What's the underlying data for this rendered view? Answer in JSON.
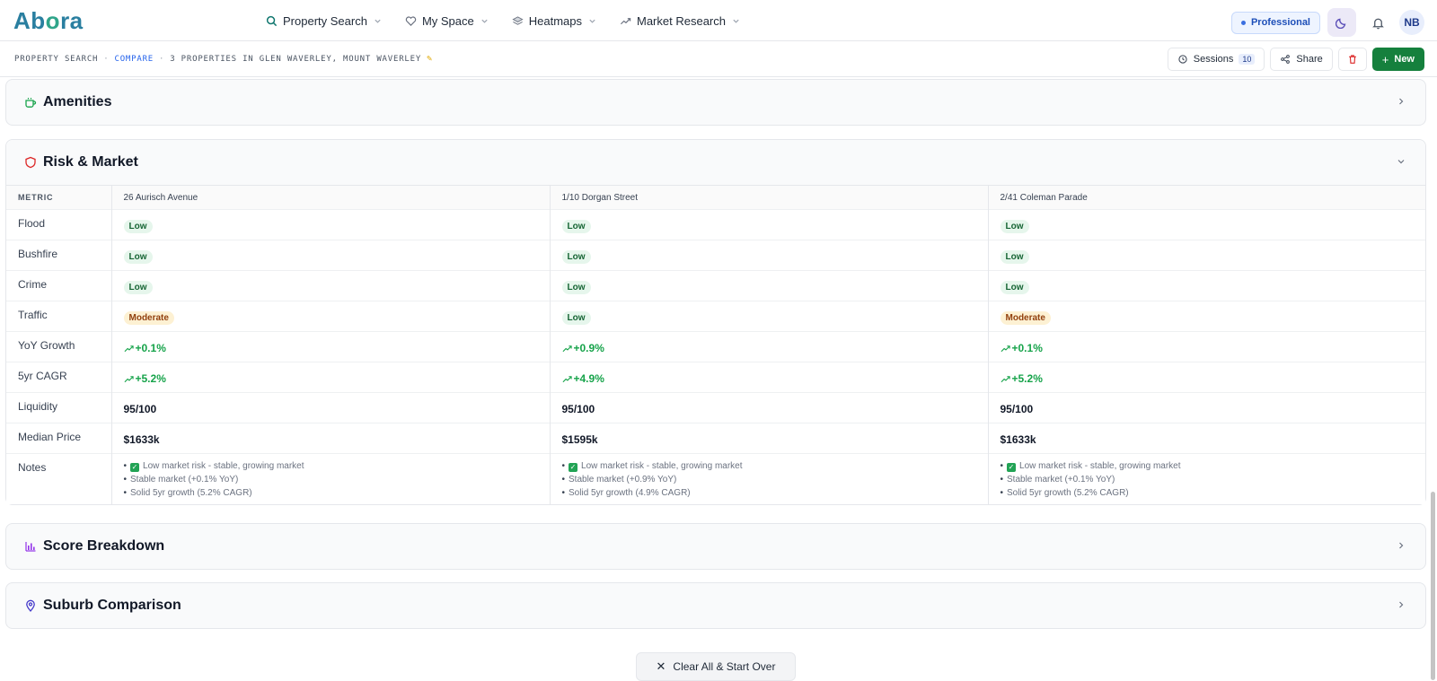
{
  "app": {
    "logo": {
      "a": "Ab",
      "o": "o",
      "ra": "ra"
    }
  },
  "nav": {
    "items": [
      {
        "label": "Property Search",
        "icon": "search-icon"
      },
      {
        "label": "My Space",
        "icon": "heart-icon"
      },
      {
        "label": "Heatmaps",
        "icon": "layers-icon"
      },
      {
        "label": "Market Research",
        "icon": "trend-icon"
      }
    ],
    "plan_badge": "Professional",
    "avatar_initials": "NB"
  },
  "breadcrumb": {
    "part1": "PROPERTY SEARCH",
    "sep": "·",
    "part2": "COMPARE",
    "part3": "3 PROPERTIES IN GLEN WAVERLEY, MOUNT WAVERLEY"
  },
  "toolbar": {
    "sessions_label": "Sessions",
    "sessions_count": "10",
    "share_label": "Share",
    "new_label": "New"
  },
  "sections": {
    "amenities": "Amenities",
    "risk": "Risk & Market",
    "score": "Score Breakdown",
    "suburb": "Suburb Comparison"
  },
  "risk_table": {
    "metric_header": "METRIC",
    "properties": [
      "26 Aurisch Avenue",
      "1/10 Dorgan Street",
      "2/41 Coleman Parade"
    ],
    "rows": {
      "flood": {
        "label": "Flood",
        "values": [
          "Low",
          "Low",
          "Low"
        ]
      },
      "bushfire": {
        "label": "Bushfire",
        "values": [
          "Low",
          "Low",
          "Low"
        ]
      },
      "crime": {
        "label": "Crime",
        "values": [
          "Low",
          "Low",
          "Low"
        ]
      },
      "traffic": {
        "label": "Traffic",
        "values": [
          "Moderate",
          "Low",
          "Moderate"
        ]
      },
      "yoy": {
        "label": "YoY Growth",
        "values": [
          "+0.1%",
          "+0.9%",
          "+0.1%"
        ]
      },
      "cagr": {
        "label": "5yr CAGR",
        "values": [
          "+5.2%",
          "+4.9%",
          "+5.2%"
        ]
      },
      "liquidity": {
        "label": "Liquidity",
        "values": [
          "95/100",
          "95/100",
          "95/100"
        ]
      },
      "median": {
        "label": "Median Price",
        "values": [
          "$1633k",
          "$1595k",
          "$1633k"
        ]
      },
      "notes": {
        "label": "Notes",
        "values": [
          [
            "Low market risk - stable, growing market",
            "Stable market (+0.1% YoY)",
            "Solid 5yr growth (5.2% CAGR)"
          ],
          [
            "Low market risk - stable, growing market",
            "Stable market (+0.9% YoY)",
            "Solid 5yr growth (4.9% CAGR)"
          ],
          [
            "Low market risk - stable, growing market",
            "Stable market (+0.1% YoY)",
            "Solid 5yr growth (5.2% CAGR)"
          ]
        ]
      }
    }
  },
  "footer": {
    "clear_label": "Clear All & Start Over"
  },
  "colors": {
    "accent_green": "#15803d",
    "low_pill": "#e6f6ec",
    "moderate_pill": "#fdf1d3"
  }
}
